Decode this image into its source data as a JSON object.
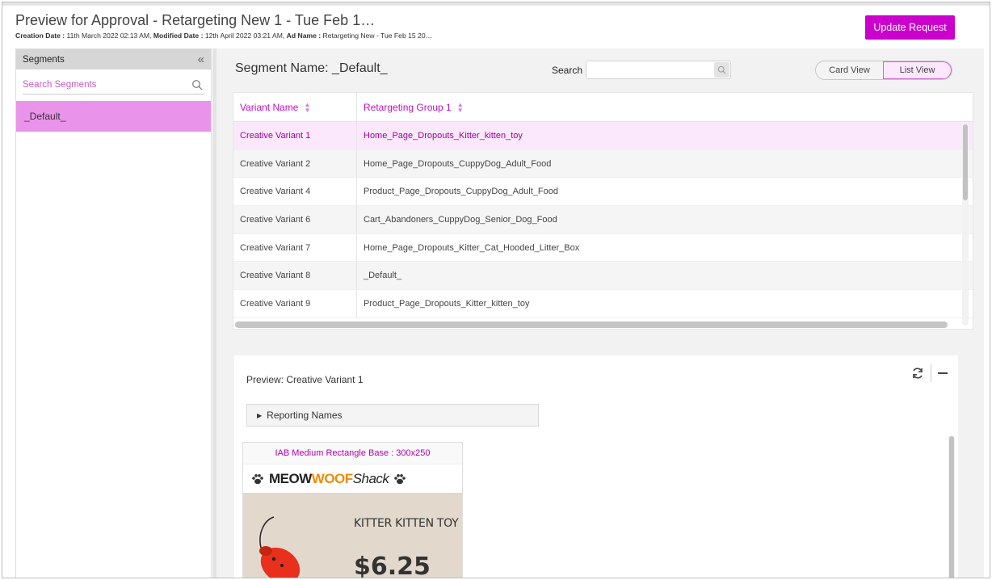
{
  "header": {
    "title": "Preview for Approval - Retargeting New 1 - Tue Feb 1…",
    "meta_creation_label": "Creation Date :",
    "meta_creation_value": "11th March 2022 02:13 AM,",
    "meta_modified_label": "Modified Date :",
    "meta_modified_value": "12th April 2022 03:21 AM,",
    "meta_ad_label": "Ad Name :",
    "meta_ad_value": "Retargeting New - Tue Feb 15 20…",
    "update_button": "Update Request"
  },
  "sidebar": {
    "title": "Segments",
    "collapse_icon": "double-chevron-left",
    "search_placeholder": "Search Segments",
    "items": [
      {
        "label": "_Default_",
        "selected": true
      }
    ]
  },
  "main": {
    "segment_name": "Segment Name: _Default_",
    "search_label": "Search",
    "search_value": "",
    "view_toggle": {
      "card": "Card View",
      "list": "List View",
      "active": "List View"
    },
    "table": {
      "headers": [
        "Variant Name",
        "Retargeting Group 1"
      ],
      "rows": [
        {
          "variant": "Creative Variant 1",
          "group": "Home_Page_Dropouts_Kitter_kitten_toy",
          "selected": true
        },
        {
          "variant": "Creative Variant 2",
          "group": "Home_Page_Dropouts_CuppyDog_Adult_Food"
        },
        {
          "variant": "Creative Variant 4",
          "group": "Product_Page_Dropouts_CuppyDog_Adult_Food"
        },
        {
          "variant": "Creative Variant 6",
          "group": "Cart_Abandoners_CuppyDog_Senior_Dog_Food"
        },
        {
          "variant": "Creative Variant 7",
          "group": "Home_Page_Dropouts_Kitter_Cat_Hooded_Litter_Box"
        },
        {
          "variant": "Creative Variant 8",
          "group": "_Default_"
        },
        {
          "variant": "Creative Variant 9",
          "group": "Product_Page_Dropouts_Kitter_kitten_toy"
        }
      ]
    },
    "preview": {
      "title": "Preview: Creative Variant 1",
      "reporting_names": "Reporting Names",
      "ad": {
        "size_label": "IAB Medium Rectangle Base : 300x250",
        "brand_part1": "MEOW",
        "brand_part2": "WOOF",
        "brand_part3": "Shack",
        "product_name": "KITTER KITTEN TOY",
        "price": "$6.25",
        "brand_colors": {
          "dark": "#222222",
          "orange": "#f08a0a",
          "background": "#e2d9cc"
        }
      }
    }
  },
  "colors": {
    "accent": "#cc00cc",
    "selected_row": "#fce8fc",
    "selected_segment": "#ea93ea"
  }
}
